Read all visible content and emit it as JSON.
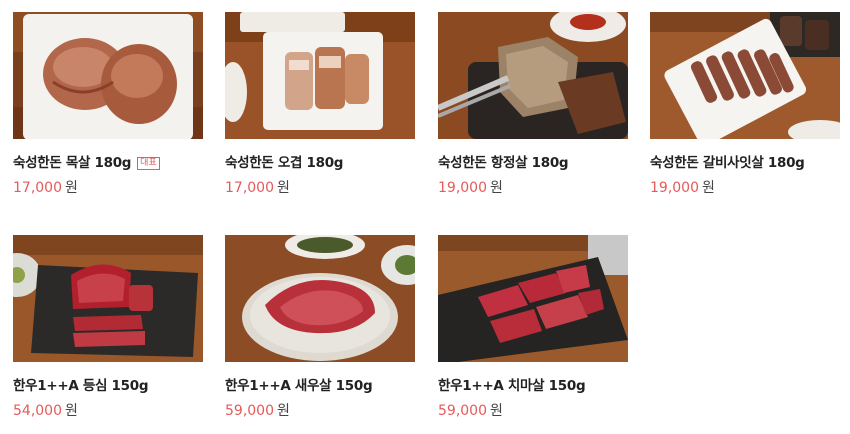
{
  "products": [
    {
      "name": "숙성한돈 목살 180g",
      "badge": "대표",
      "price": "17,000",
      "unit": "원",
      "image": "pork-neck-on-white-plate"
    },
    {
      "name": "숙성한돈 오겹 180g",
      "badge": "",
      "price": "17,000",
      "unit": "원",
      "image": "pork-belly-on-white-plate"
    },
    {
      "name": "숙성한돈 항정살 180g",
      "badge": "",
      "price": "19,000",
      "unit": "원",
      "image": "pork-jowl-with-tongs"
    },
    {
      "name": "숙성한돈 갈비사잇살 180g",
      "badge": "",
      "price": "19,000",
      "unit": "원",
      "image": "pork-rib-finger-on-white-plate"
    },
    {
      "name": "한우1++A 등심 150g",
      "badge": "",
      "price": "54,000",
      "unit": "원",
      "image": "beef-sirloin-on-black-stone"
    },
    {
      "name": "한우1++A 새우살 150g",
      "badge": "",
      "price": "59,000",
      "unit": "원",
      "image": "beef-ribeye-cap-on-stone-plate"
    },
    {
      "name": "한우1++A 치마살 150g",
      "badge": "",
      "price": "59,000",
      "unit": "원",
      "image": "beef-flank-on-black-slate"
    }
  ]
}
